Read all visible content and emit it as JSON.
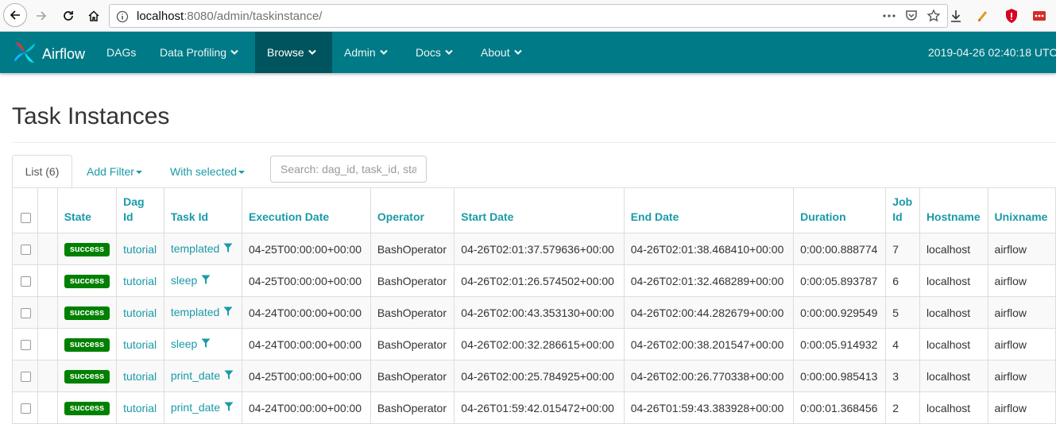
{
  "browser": {
    "url_host": "localhost",
    "url_rest": ":8080/admin/taskinstance/"
  },
  "navbar": {
    "brand": "Airflow",
    "items": [
      {
        "label": "DAGs",
        "dropdown": false
      },
      {
        "label": "Data Profiling",
        "dropdown": true
      },
      {
        "label": "Browse",
        "dropdown": true,
        "active": true
      },
      {
        "label": "Admin",
        "dropdown": true
      },
      {
        "label": "Docs",
        "dropdown": true
      },
      {
        "label": "About",
        "dropdown": true
      }
    ],
    "clock": "2019-04-26 02:40:18 UTC"
  },
  "page": {
    "title": "Task Instances"
  },
  "tabs": {
    "list": "List (6)",
    "add_filter": "Add Filter",
    "with_selected": "With selected",
    "search_placeholder": "Search: dag_id, task_id, state"
  },
  "table": {
    "headers": {
      "state": "State",
      "dag_id": "Dag Id",
      "task_id": "Task Id",
      "execution_date": "Execution Date",
      "operator": "Operator",
      "start_date": "Start Date",
      "end_date": "End Date",
      "duration": "Duration",
      "job_id": "Job Id",
      "hostname": "Hostname",
      "unixname": "Unixname"
    },
    "rows": [
      {
        "state": "success",
        "dag_id": "tutorial",
        "task_id": "templated",
        "execution_date": "04-25T00:00:00+00:00",
        "operator": "BashOperator",
        "start_date": "04-26T02:01:37.579636+00:00",
        "end_date": "04-26T02:01:38.468410+00:00",
        "duration": "0:00:00.888774",
        "job_id": "7",
        "hostname": "localhost",
        "unixname": "airflow"
      },
      {
        "state": "success",
        "dag_id": "tutorial",
        "task_id": "sleep",
        "execution_date": "04-25T00:00:00+00:00",
        "operator": "BashOperator",
        "start_date": "04-26T02:01:26.574502+00:00",
        "end_date": "04-26T02:01:32.468289+00:00",
        "duration": "0:00:05.893787",
        "job_id": "6",
        "hostname": "localhost",
        "unixname": "airflow"
      },
      {
        "state": "success",
        "dag_id": "tutorial",
        "task_id": "templated",
        "execution_date": "04-24T00:00:00+00:00",
        "operator": "BashOperator",
        "start_date": "04-26T02:00:43.353130+00:00",
        "end_date": "04-26T02:00:44.282679+00:00",
        "duration": "0:00:00.929549",
        "job_id": "5",
        "hostname": "localhost",
        "unixname": "airflow"
      },
      {
        "state": "success",
        "dag_id": "tutorial",
        "task_id": "sleep",
        "execution_date": "04-24T00:00:00+00:00",
        "operator": "BashOperator",
        "start_date": "04-26T02:00:32.286615+00:00",
        "end_date": "04-26T02:00:38.201547+00:00",
        "duration": "0:00:05.914932",
        "job_id": "4",
        "hostname": "localhost",
        "unixname": "airflow"
      },
      {
        "state": "success",
        "dag_id": "tutorial",
        "task_id": "print_date",
        "execution_date": "04-25T00:00:00+00:00",
        "operator": "BashOperator",
        "start_date": "04-26T02:00:25.784925+00:00",
        "end_date": "04-26T02:00:26.770338+00:00",
        "duration": "0:00:00.985413",
        "job_id": "3",
        "hostname": "localhost",
        "unixname": "airflow"
      },
      {
        "state": "success",
        "dag_id": "tutorial",
        "task_id": "print_date",
        "execution_date": "04-24T00:00:00+00:00",
        "operator": "BashOperator",
        "start_date": "04-26T01:59:42.015472+00:00",
        "end_date": "04-26T01:59:43.383928+00:00",
        "duration": "0:00:01.368456",
        "job_id": "2",
        "hostname": "localhost",
        "unixname": "airflow"
      }
    ]
  },
  "colors": {
    "navbar": "#007a87",
    "navbar_active": "#00545d",
    "link": "#1a9aa8",
    "success": "#008000"
  },
  "icons": [
    "back-icon",
    "forward-icon",
    "reload-icon",
    "home-icon",
    "info-icon",
    "more-icon",
    "pocket-icon",
    "bookmark-star-icon",
    "download-icon",
    "extension-icon",
    "shield-icon",
    "lastpass-icon",
    "filter-icon",
    "pinwheel-logo-icon"
  ]
}
